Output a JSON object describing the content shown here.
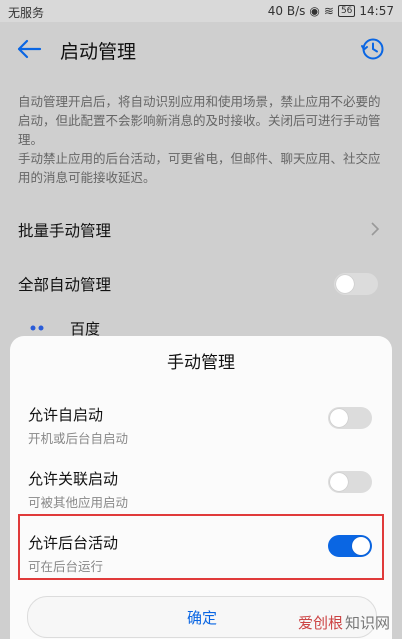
{
  "status_bar": {
    "carrier": "无服务",
    "speed": "40 B/s",
    "battery": "56",
    "time": "14:57"
  },
  "header": {
    "title": "启动管理"
  },
  "description": {
    "p1": "自动管理开启后，将自动识别应用和使用场景，禁止应用不必要的启动，但此配置不会影响新消息的及时接收。关闭后可进行手动管理。",
    "p2": "手动禁止应用的后台活动，可更省电，但邮件、聊天应用、社交应用的消息可能接收延迟。"
  },
  "list": {
    "batch_manual": "批量手动管理",
    "all_auto": "全部自动管理",
    "all_auto_on": false,
    "app_name": "百度"
  },
  "sheet": {
    "title": "手动管理",
    "options": [
      {
        "title": "允许自启动",
        "subtitle": "开机或后台自启动",
        "on": false
      },
      {
        "title": "允许关联启动",
        "subtitle": "可被其他应用启动",
        "on": false
      },
      {
        "title": "允许后台活动",
        "subtitle": "可在后台运行",
        "on": true
      }
    ],
    "confirm": "确定"
  },
  "watermark": {
    "brand": "爱创根",
    "text": "知识网"
  },
  "colors": {
    "accent": "#0a66e3",
    "highlight": "#e03a3a"
  }
}
